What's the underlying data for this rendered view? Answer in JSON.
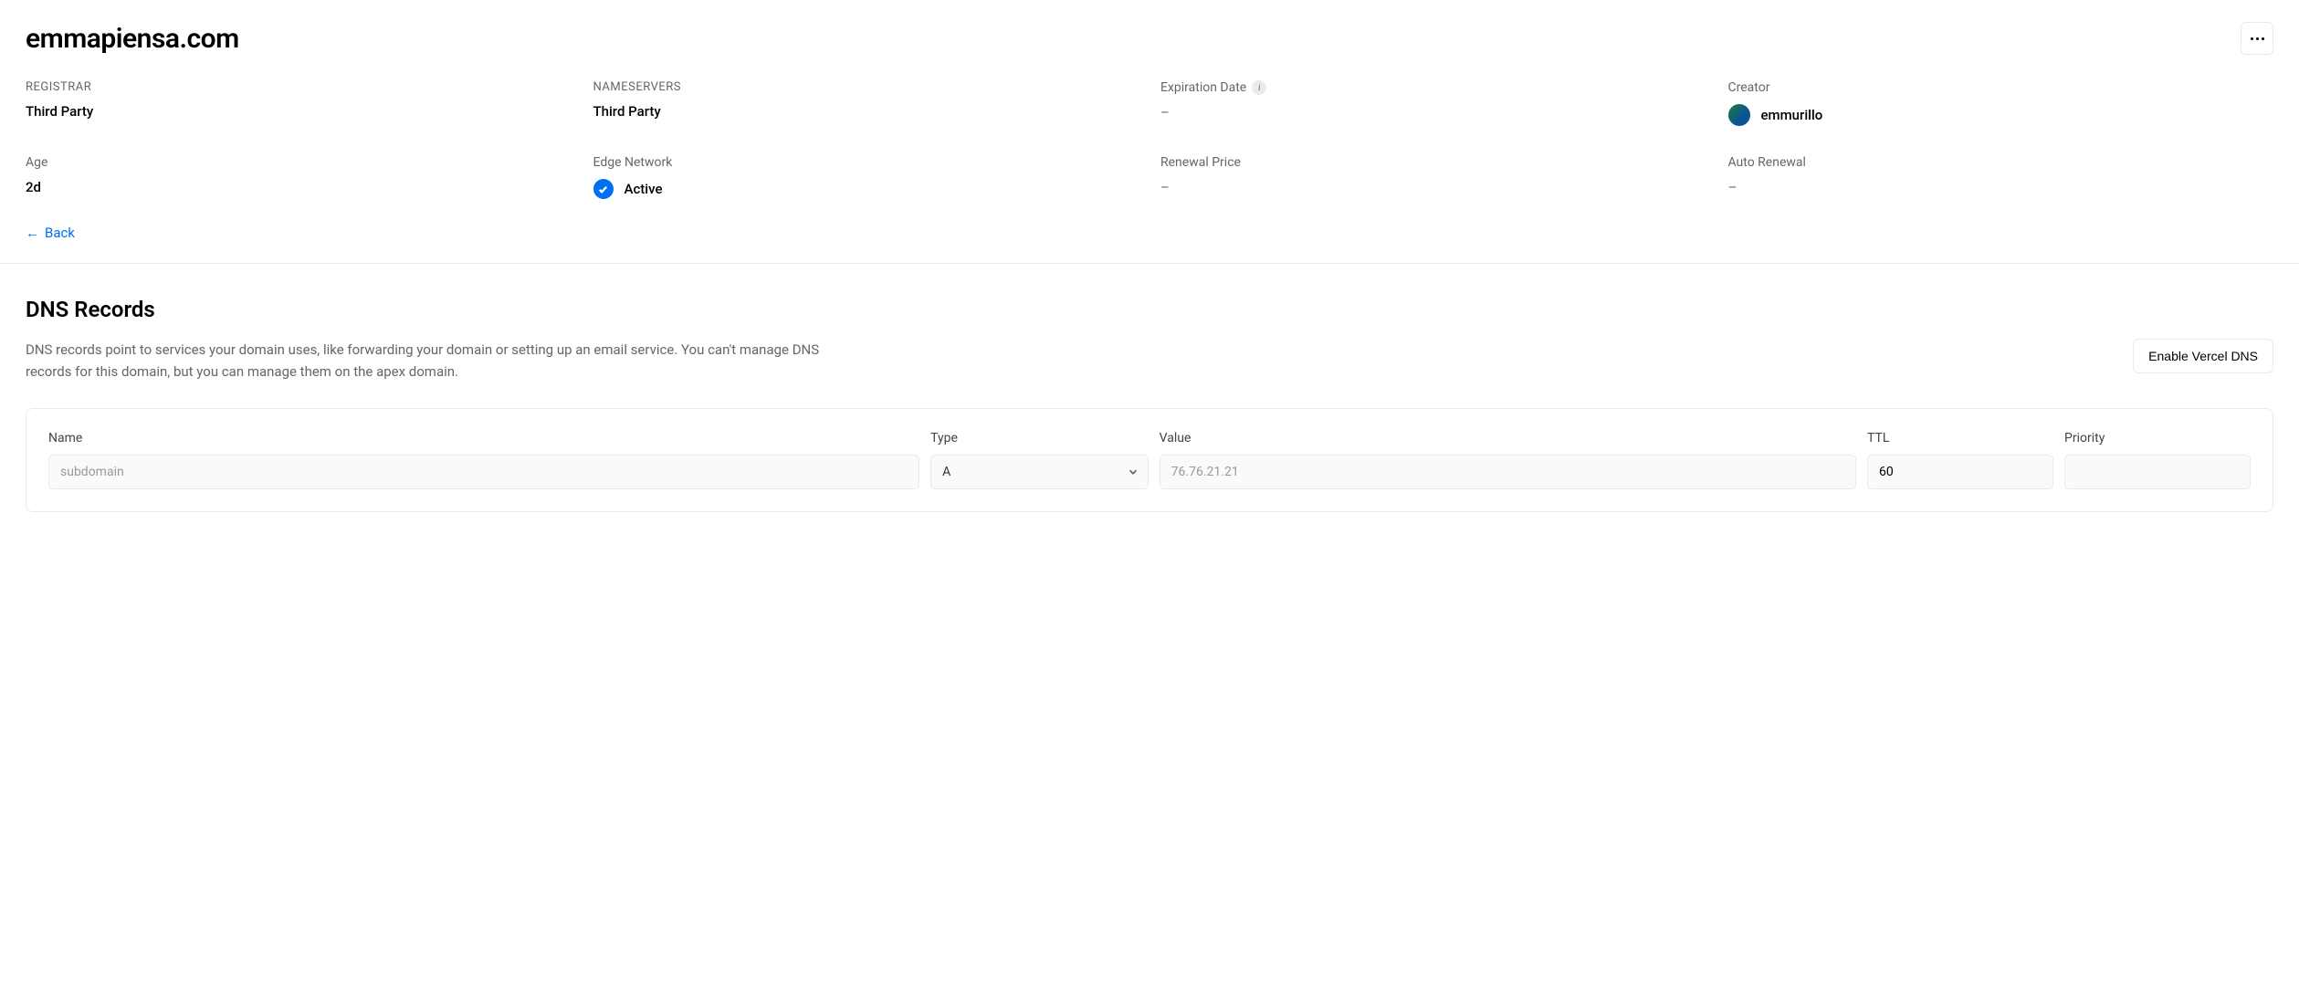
{
  "header": {
    "title": "emmapiensa.com"
  },
  "info": {
    "registrar": {
      "label": "REGISTRAR",
      "value": "Third Party"
    },
    "nameservers": {
      "label": "NAMESERVERS",
      "value": "Third Party"
    },
    "expiration": {
      "label": "Expiration Date",
      "value": "–"
    },
    "creator": {
      "label": "Creator",
      "value": "emmurillo"
    },
    "age": {
      "label": "Age",
      "value": "2d"
    },
    "edge_network": {
      "label": "Edge Network",
      "value": "Active"
    },
    "renewal_price": {
      "label": "Renewal Price",
      "value": "–"
    },
    "auto_renewal": {
      "label": "Auto Renewal",
      "value": "–"
    }
  },
  "back": {
    "label": "Back"
  },
  "dns": {
    "title": "DNS Records",
    "description": "DNS records point to services your domain uses, like forwarding your domain or setting up an email service. You can't manage DNS records for this domain, but you can manage them on the apex domain.",
    "enable_button": "Enable Vercel DNS",
    "form": {
      "name": {
        "label": "Name",
        "placeholder": "subdomain",
        "value": ""
      },
      "type": {
        "label": "Type",
        "value": "A"
      },
      "value": {
        "label": "Value",
        "placeholder": "76.76.21.21",
        "value": ""
      },
      "ttl": {
        "label": "TTL",
        "value": "60"
      },
      "priority": {
        "label": "Priority",
        "value": ""
      }
    }
  }
}
